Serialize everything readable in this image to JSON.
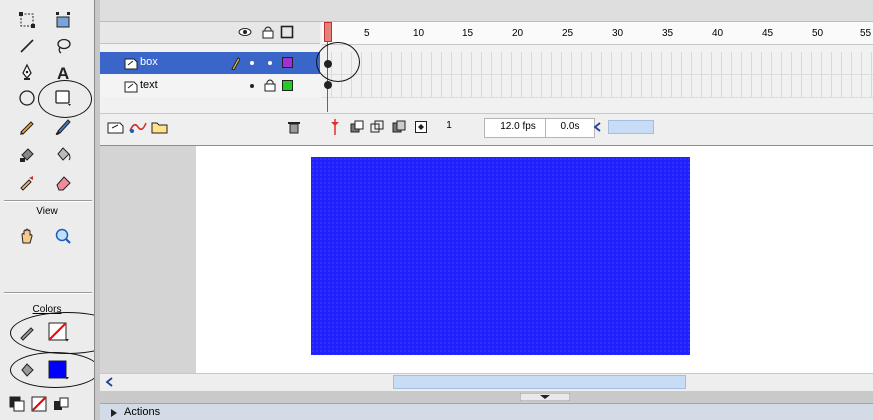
{
  "app": "Flash authoring environment",
  "toolbar": {
    "view_label": "View",
    "colors_label": "Colors",
    "stroke_color": "#ff0000",
    "fill_color": "#0000ff",
    "tools": [
      "free-transform-icon",
      "fill-transform-icon",
      "line-icon",
      "lasso-icon",
      "pen-icon",
      "text-icon",
      "oval-icon",
      "rectangle-icon",
      "pencil-icon",
      "brush-icon",
      "ink-bottle-icon",
      "paint-bucket-icon",
      "eyedropper-icon",
      "eraser-icon",
      "hand-icon",
      "zoom-icon"
    ]
  },
  "timeline": {
    "ruler": [
      "5",
      "10",
      "15",
      "20",
      "25",
      "30",
      "35",
      "40",
      "45",
      "50",
      "55"
    ],
    "current_frame": "1",
    "fps": "12.0 fps",
    "elapsed": "0.0s",
    "layers": [
      {
        "name": "box",
        "selected": true,
        "color": "#9f2fd6"
      },
      {
        "name": "text",
        "selected": false,
        "color": "#22cc22"
      }
    ]
  },
  "stage": {
    "rectangle_fill": "#2121ff"
  },
  "panels": {
    "actions": "Actions"
  }
}
